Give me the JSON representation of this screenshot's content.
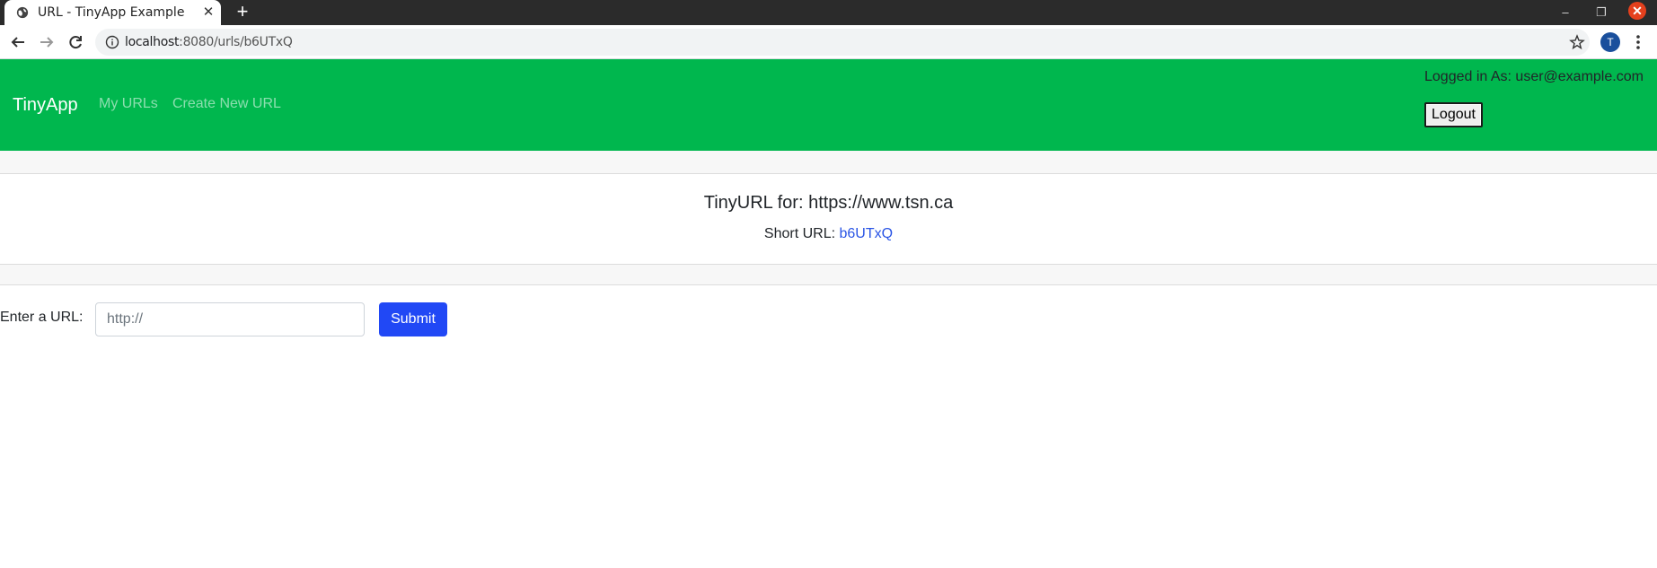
{
  "browser": {
    "tab_title": "URL - TinyApp Example",
    "url_host": "localhost",
    "url_rest": ":8080/urls/b6UTxQ",
    "profile_initial": "T",
    "icons": [
      "globe-icon",
      "close-icon",
      "plus-icon",
      "back-icon",
      "forward-icon",
      "reload-icon",
      "info-icon",
      "star-icon",
      "menu-icon",
      "minimize-icon",
      "restore-icon"
    ]
  },
  "navbar": {
    "brand": "TinyApp",
    "links": [
      "My URLs",
      "Create New URL"
    ],
    "logged_in_text": "Logged in As: user@example.com",
    "logout_label": "Logout",
    "color": "#00b74e"
  },
  "detail": {
    "title": "TinyURL for: https://www.tsn.ca",
    "short_label": "Short URL: ",
    "short_value": "b6UTxQ"
  },
  "form": {
    "label": "Enter a URL:",
    "placeholder": "http://",
    "submit_label": "Submit",
    "submit_color": "#2148f5"
  }
}
